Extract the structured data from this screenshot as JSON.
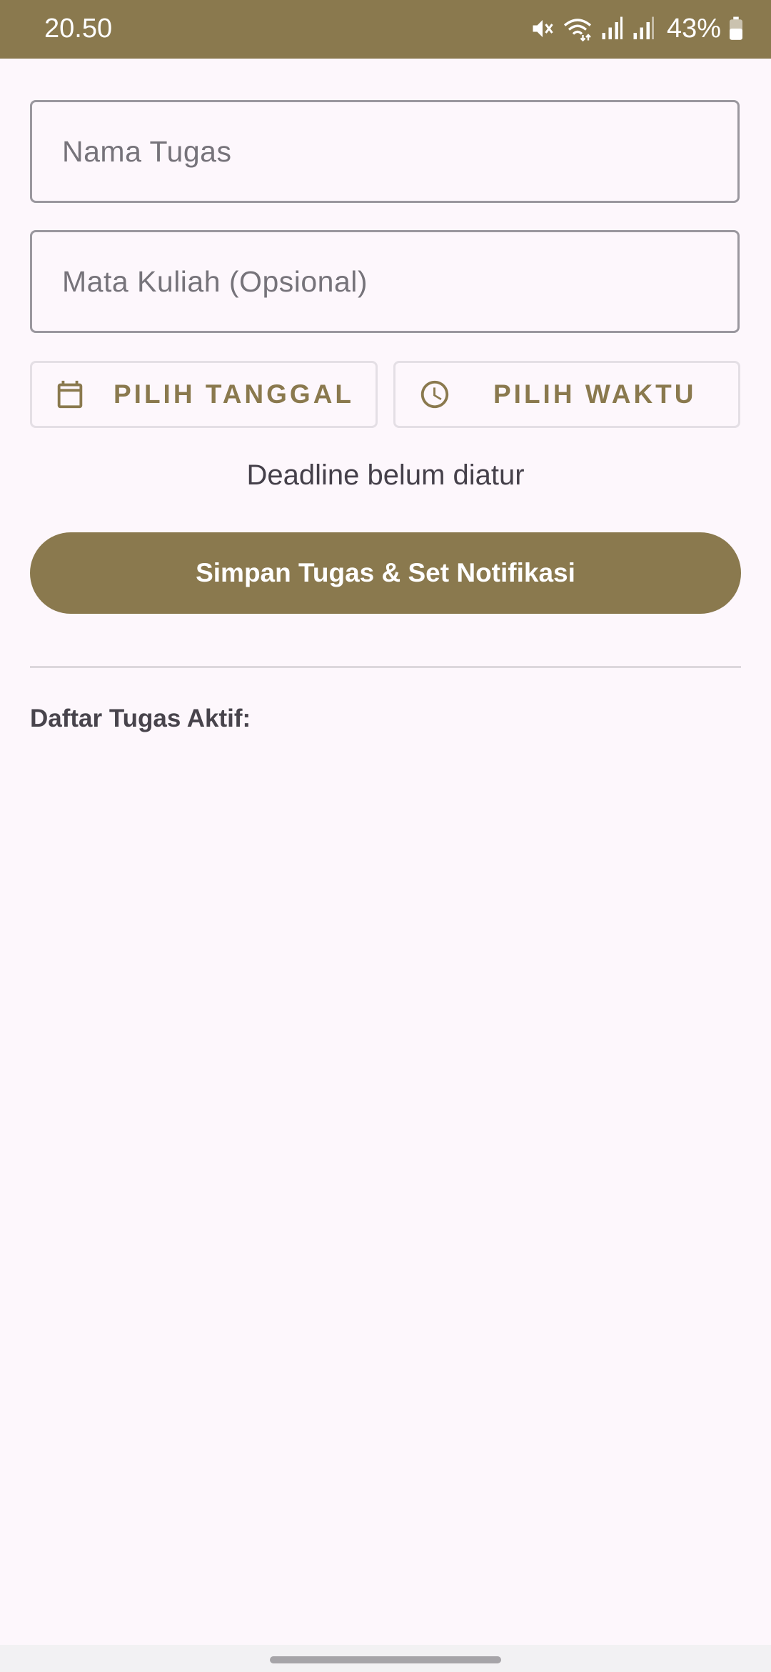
{
  "status_bar": {
    "time": "20.50",
    "battery_percent": "43%",
    "icons": [
      "mute-icon",
      "wifi-icon",
      "signal-icon",
      "signal-icon",
      "battery-icon"
    ]
  },
  "form": {
    "task_name_placeholder": "Nama Tugas",
    "course_placeholder": "Mata Kuliah (Opsional)",
    "pick_date_label": "PILIH TANGGAL",
    "pick_date_icon": "calendar-icon",
    "pick_time_label": "PILIH WAKTU",
    "pick_time_icon": "clock-icon",
    "deadline_status": "Deadline belum diatur",
    "save_button_label": "Simpan Tugas & Set Notifikasi"
  },
  "task_list": {
    "title": "Daftar Tugas Aktif:",
    "items": []
  },
  "colors": {
    "primary": "#8A794E",
    "background": "#FDF7FC",
    "outline": "#9A979E"
  }
}
